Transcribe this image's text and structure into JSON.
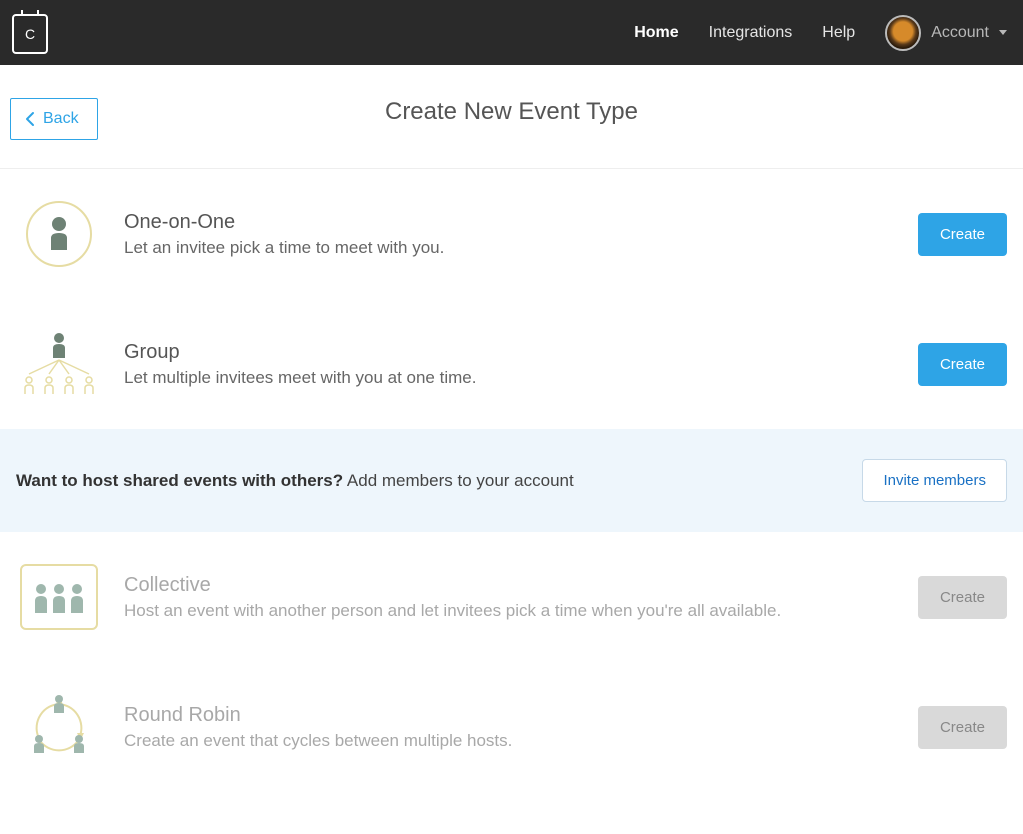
{
  "header": {
    "logo_letter": "C",
    "nav": {
      "home": "Home",
      "integrations": "Integrations",
      "help": "Help"
    },
    "account_label": "Account"
  },
  "subheader": {
    "back_label": "Back",
    "page_title": "Create New Event Type"
  },
  "event_types": {
    "one_on_one": {
      "title": "One-on-One",
      "desc": "Let an invitee pick a time to meet with you.",
      "button": "Create"
    },
    "group": {
      "title": "Group",
      "desc": "Let multiple invitees meet with you at one time.",
      "button": "Create"
    },
    "collective": {
      "title": "Collective",
      "desc": "Host an event with another person and let invitees pick a time when you're all available.",
      "button": "Create"
    },
    "round_robin": {
      "title": "Round Robin",
      "desc": "Create an event that cycles between multiple hosts.",
      "button": "Create"
    }
  },
  "banner": {
    "strong": "Want to host shared events with others?",
    "rest": " Add members to your account",
    "invite_label": "Invite members"
  },
  "colors": {
    "accent": "#2ea4e6",
    "header_bg": "#2a2a2a",
    "banner_bg": "#eef6fc"
  }
}
